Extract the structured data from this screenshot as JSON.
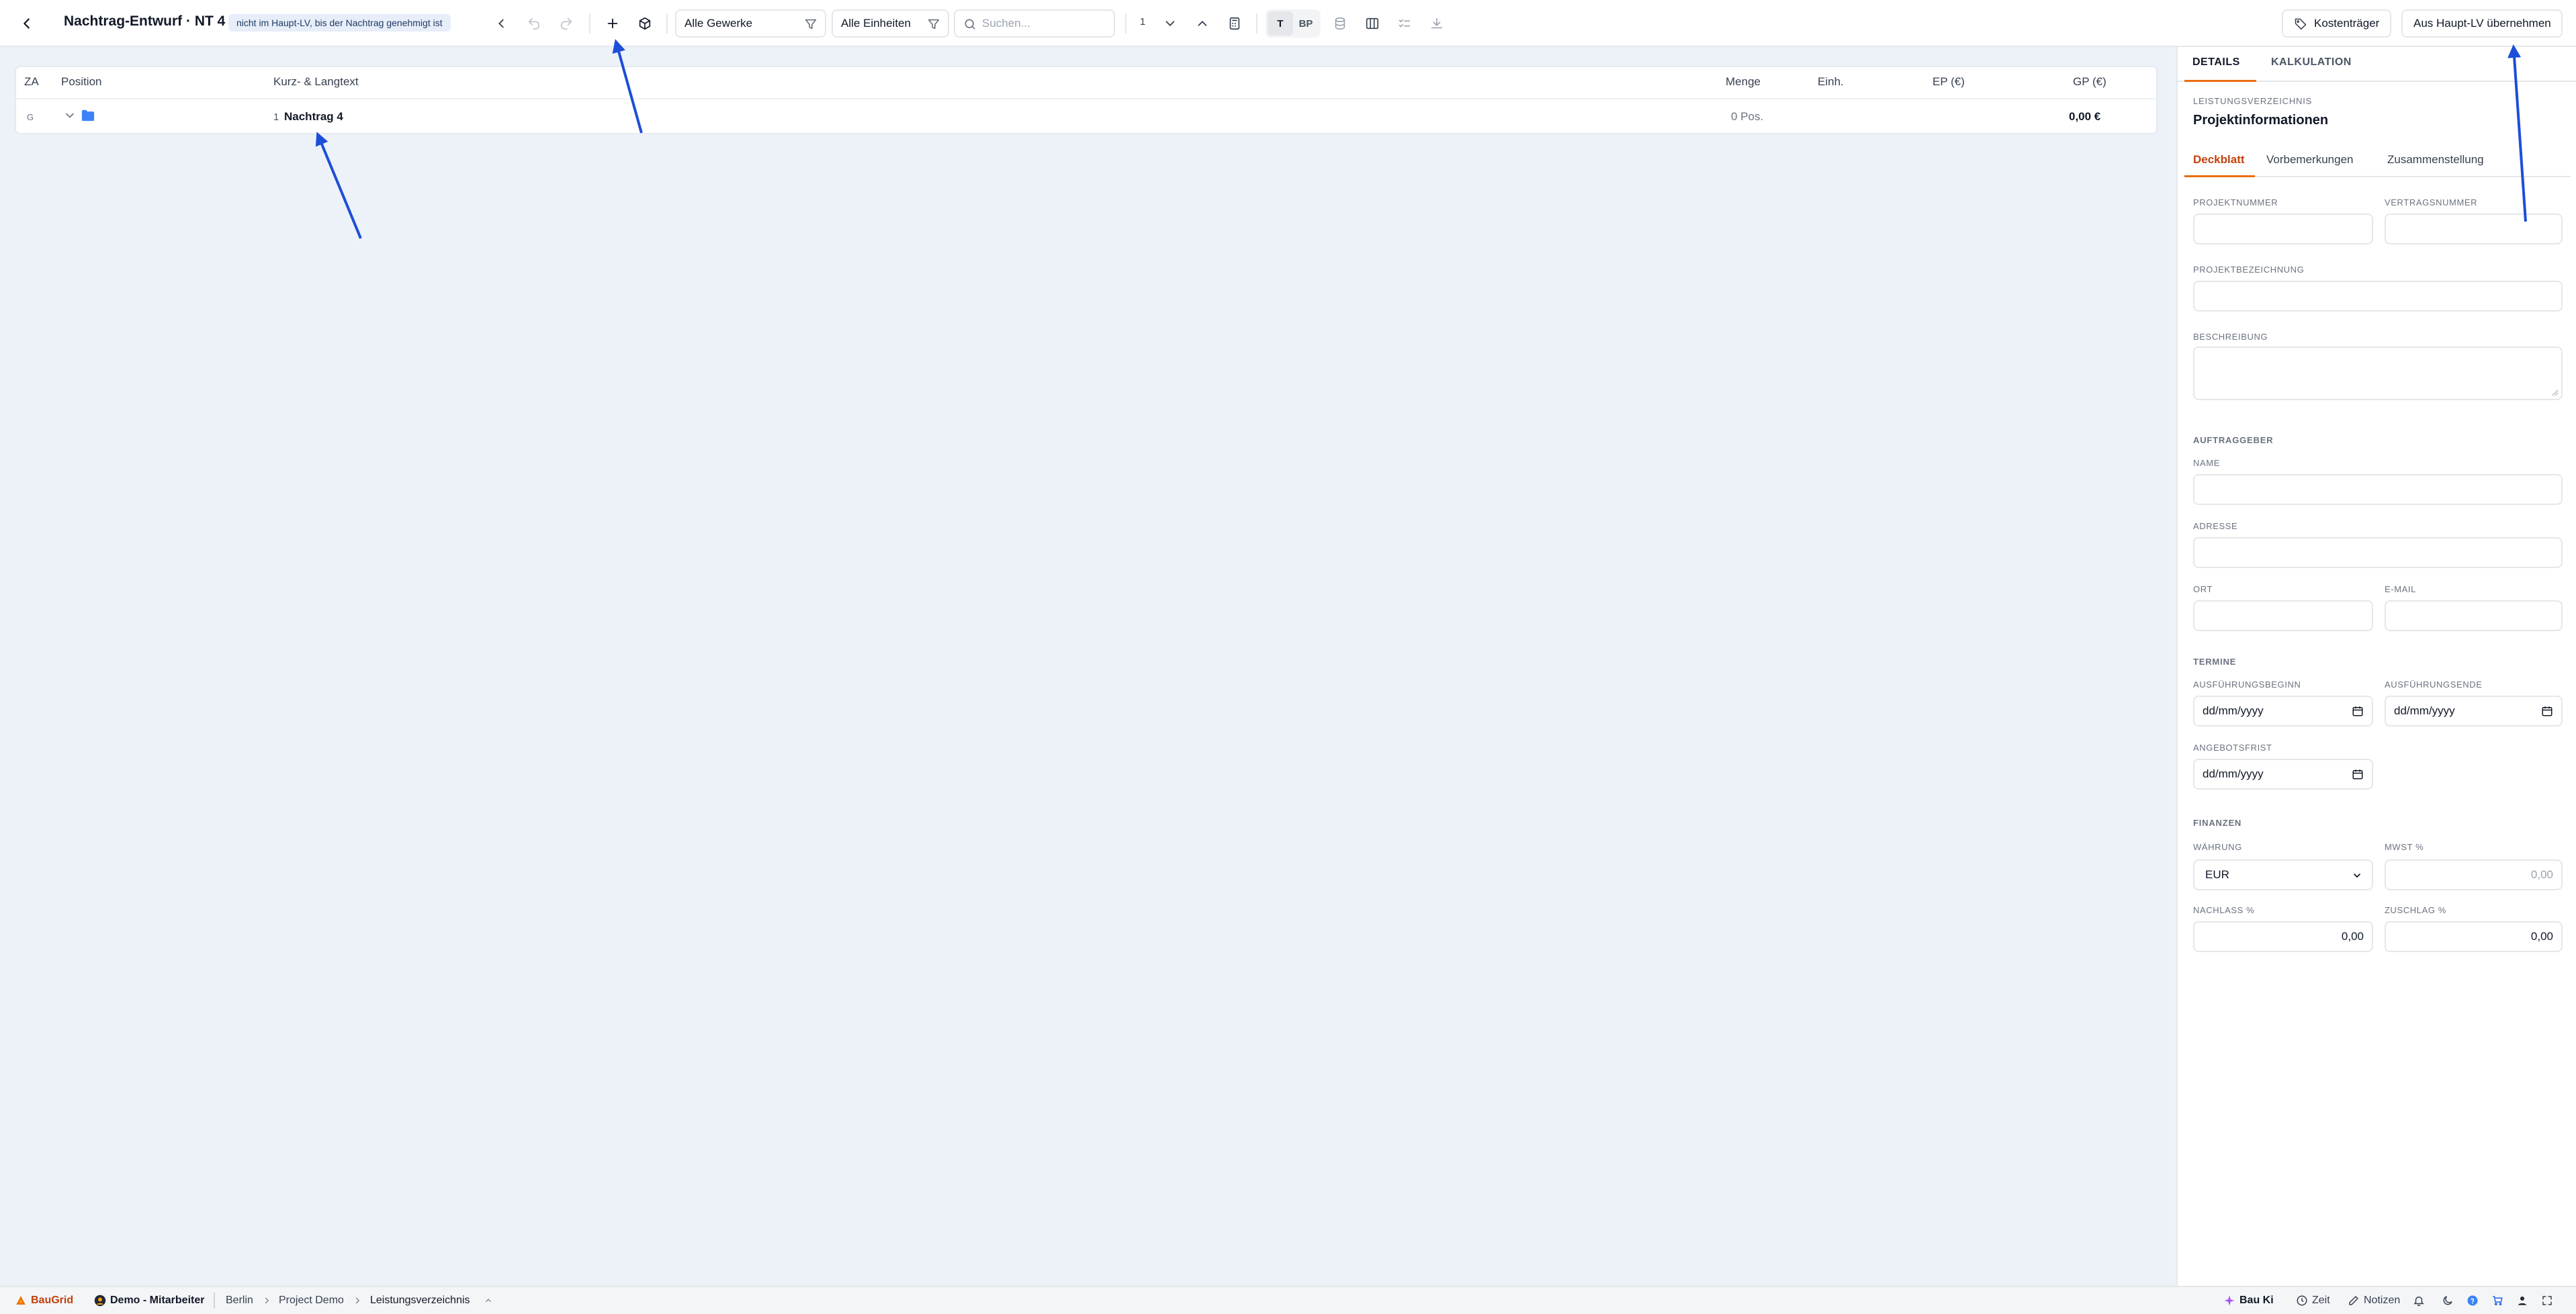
{
  "header": {
    "title": "Nachtrag-Entwurf · NT 4",
    "badge": "nicht im Haupt-LV, bis der Nachtrag genehmigt ist",
    "filter_gewerke": "Alle Gewerke",
    "filter_einheiten": "Alle Einheiten",
    "search_placeholder": "Suchen...",
    "level_value": "1",
    "toggle_t": "T",
    "toggle_bp": "BP",
    "kostentraeger_label": "Kostenträger",
    "aus_haupt_lv_label": "Aus Haupt-LV übernehmen"
  },
  "table": {
    "columns": {
      "za": "ZA",
      "position": "Position",
      "kurztext": "Kurz- & Langtext",
      "menge": "Menge",
      "einheit": "Einh.",
      "ep": "EP (€)",
      "gp": "GP (€)"
    },
    "rows": [
      {
        "za": "G",
        "number": "1",
        "text": "Nachtrag 4",
        "menge": "0 Pos.",
        "gp": "0,00 €"
      }
    ]
  },
  "panel": {
    "tabs": [
      "DETAILS",
      "KALKULATION"
    ],
    "sub_label": "LEISTUNGSVERZEICHNIS",
    "sub_title": "Projektinformationen",
    "subtabs": [
      "Deckblatt",
      "Vorbemerkungen",
      "Zusammenstellung"
    ],
    "labels": {
      "projektnummer": "PROJEKTNUMMER",
      "vertragsnummer": "VERTRAGSNUMMER",
      "projektbezeichnung": "PROJEKTBEZEICHNUNG",
      "beschreibung": "BESCHREIBUNG",
      "auftraggeber": "AUFTRAGGEBER",
      "name": "NAME",
      "adresse": "ADRESSE",
      "ort": "ORT",
      "email": "E-MAIL",
      "termine": "TERMINE",
      "ausfuehrungsbeginn": "AUSFÜHRUNGSBEGINN",
      "ausfuehrungsende": "AUSFÜHRUNGSENDE",
      "angebotsfrist": "ANGEBOTSFRIST",
      "finanzen": "FINANZEN",
      "waehrung": "WÄHRUNG",
      "mwst": "MWST %",
      "nachlass": "NACHLASS %",
      "zuschlag": "ZUSCHLAG %"
    },
    "values": {
      "date_placeholder": "dd/mm/yyyy",
      "waehrung": "EUR",
      "mwst_placeholder": "0,00",
      "nachlass": "0,00",
      "zuschlag": "0,00"
    }
  },
  "footer": {
    "brand": "BauGrid",
    "user": "Demo - Mitarbeiter",
    "breadcrumb": [
      "Berlin",
      "Project Demo",
      "Leistungsverzeichnis"
    ],
    "bau_ki": "Bau Ki",
    "zeit": "Zeit",
    "notizen": "Notizen"
  },
  "colors": {
    "accent": "#ea6d0e",
    "arrow": "#1d4ed8",
    "folder": "#3b82f6",
    "background": "#edf2f9"
  }
}
